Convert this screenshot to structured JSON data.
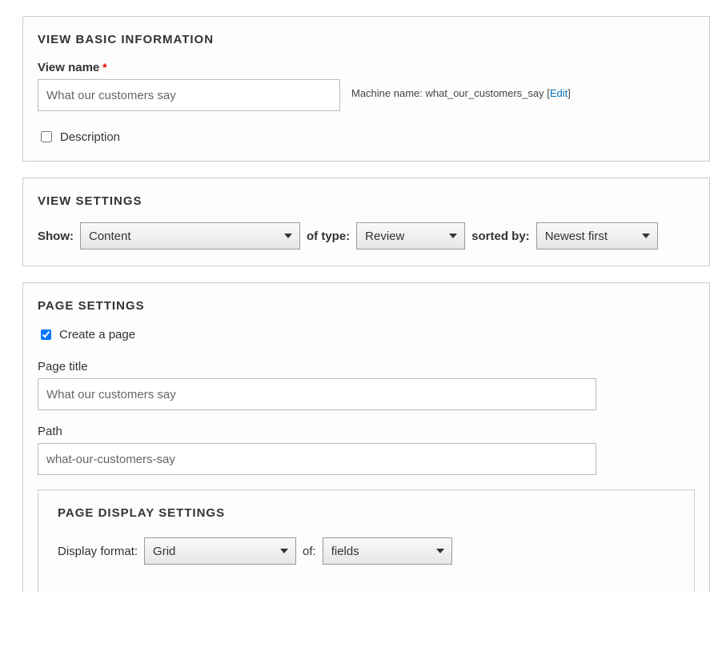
{
  "basic": {
    "section_title": "VIEW BASIC INFORMATION",
    "view_name_label": "View name",
    "view_name_value": "What our customers say",
    "machine_name_label": "Machine name:",
    "machine_name_value": "what_our_customers_say",
    "edit_label": "Edit",
    "description_label": "Description"
  },
  "view_settings": {
    "section_title": "VIEW SETTINGS",
    "show_label": "Show:",
    "show_value": "Content",
    "of_type_label": "of type:",
    "of_type_value": "Review",
    "sorted_by_label": "sorted by:",
    "sorted_by_value": "Newest first"
  },
  "page_settings": {
    "section_title": "PAGE SETTINGS",
    "create_page_label": "Create a page",
    "page_title_label": "Page title",
    "page_title_value": "What our customers say",
    "path_label": "Path",
    "path_value": "what-our-customers-say",
    "display": {
      "section_title": "PAGE DISPLAY SETTINGS",
      "format_label": "Display format:",
      "format_value": "Grid",
      "of_label": "of:",
      "of_value": "fields"
    }
  }
}
